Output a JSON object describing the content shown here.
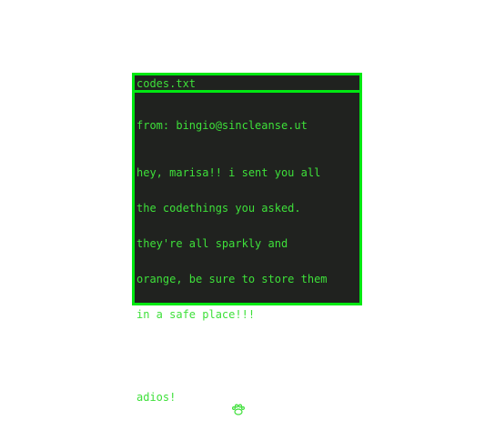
{
  "window": {
    "title": "codes.txt"
  },
  "message": {
    "from": "from: bingio@sincleanse.ut",
    "lines": [
      "hey, marisa!! i sent you all",
      "the codethings you asked.",
      "they're all sparkly and",
      "orange, be sure to store them",
      "in a safe place!!!"
    ],
    "signoff": "adios!",
    "signoff_icon": "paw-print-icon"
  },
  "colors": {
    "accent": "#00e812",
    "text": "#3ee03a",
    "background": "#20221f"
  }
}
